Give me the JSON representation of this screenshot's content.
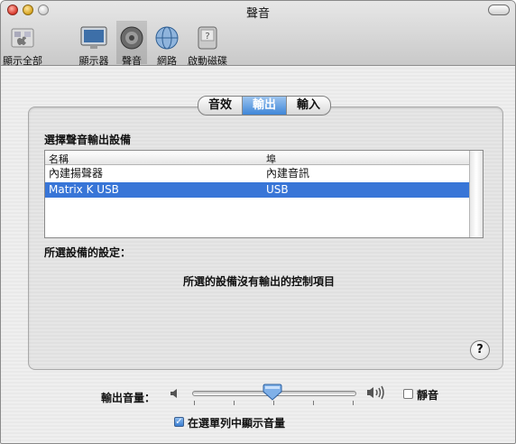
{
  "window": {
    "title": "聲音"
  },
  "toolbar": {
    "items": [
      {
        "label": "顯示全部",
        "icon": "apple-icon"
      },
      {
        "label": "顯示器",
        "icon": "display-icon"
      },
      {
        "label": "聲音",
        "icon": "speaker-icon",
        "selected": true
      },
      {
        "label": "網路",
        "icon": "network-globe-icon"
      },
      {
        "label": "啟動磁碟",
        "icon": "startup-disk-icon"
      }
    ]
  },
  "tabs": [
    {
      "label": "音效",
      "selected": false
    },
    {
      "label": "輸出",
      "selected": true
    },
    {
      "label": "輸入",
      "selected": false
    }
  ],
  "output": {
    "choose_label": "選擇聲音輸出設備",
    "columns": {
      "name": "名稱",
      "port": "埠"
    },
    "devices": [
      {
        "name": "內建揚聲器",
        "port": "內建音訊",
        "selected": false
      },
      {
        "name": "Matrix K USB",
        "port": "USB",
        "selected": true
      }
    ],
    "settings_label": "所選設備的設定：",
    "no_controls_text": "所選的設備沒有輸出的控制項目",
    "help": "?"
  },
  "volume": {
    "label": "輸出音量：",
    "level": 0.5,
    "mute_label": "靜音",
    "mute_checked": false,
    "show_in_menubar_label": "在選單列中顯示音量",
    "show_in_menubar_checked": true
  },
  "colors": {
    "selection": "#3875d7",
    "tab_selected": "#3f86d8"
  }
}
